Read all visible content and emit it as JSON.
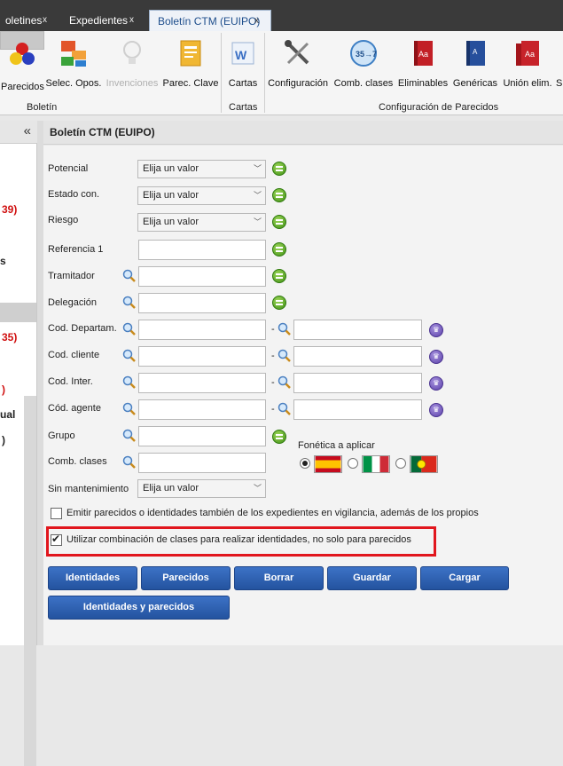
{
  "tabs": [
    {
      "label": "oletines",
      "close": "x"
    },
    {
      "label": "Expedientes",
      "close": "x"
    },
    {
      "label": "Boletín CTM (EUIPO)",
      "close": "x",
      "active": true
    }
  ],
  "ribbon": {
    "buttons": [
      {
        "label": "Parecidos",
        "icon": "dots-icon",
        "selected": true
      },
      {
        "label": "Selec. Opos.",
        "icon": "blocks-icon"
      },
      {
        "label": "Invenciones",
        "icon": "bulb-icon",
        "disabled": true
      },
      {
        "label": "Parec. Clave",
        "icon": "key-card-icon"
      },
      {
        "label": "Cartas",
        "icon": "word-doc-icon"
      },
      {
        "label": "Configuración",
        "icon": "tools-icon"
      },
      {
        "label": "Comb. clases",
        "icon": "combine-classes-icon"
      },
      {
        "label": "Eliminables",
        "icon": "red-dictionary-icon"
      },
      {
        "label": "Genéricas",
        "icon": "blue-book-icon"
      },
      {
        "label": "Unión elim.",
        "icon": "red-books-icon"
      },
      {
        "label": "S",
        "icon": ""
      }
    ],
    "groups": [
      "Boletín",
      "Cartas",
      "Configuración de Parecidos"
    ]
  },
  "left_panel": {
    "collapse": "«",
    "fragments": [
      {
        "text": "39)",
        "red": true
      },
      {
        "text": "s",
        "red": false
      },
      {
        "text": "35)",
        "red": true
      },
      {
        "text": ")",
        "red": true
      },
      {
        "text": "ual",
        "red": false
      },
      {
        "text": ")",
        "red": false
      }
    ]
  },
  "panel": {
    "title": "Boletín CTM (EUIPO)",
    "fields": {
      "potencial": {
        "label": "Potencial",
        "value": "Elija un valor"
      },
      "estado": {
        "label": "Estado con.",
        "value": "Elija un valor"
      },
      "riesgo": {
        "label": "Riesgo",
        "value": "Elija un valor"
      },
      "referencia": {
        "label": "Referencia 1",
        "value": ""
      },
      "tramitador": {
        "label": "Tramitador",
        "value": ""
      },
      "delegacion": {
        "label": "Delegación",
        "value": ""
      },
      "departam": {
        "label": "Cod. Departam.",
        "from": "",
        "to": ""
      },
      "cliente": {
        "label": "Cod. cliente",
        "from": "",
        "to": ""
      },
      "inter": {
        "label": "Cod. Inter.",
        "from": "",
        "to": ""
      },
      "agente": {
        "label": "Cód. agente",
        "from": "",
        "to": ""
      },
      "grupo": {
        "label": "Grupo",
        "value": ""
      },
      "comb": {
        "label": "Comb. clases",
        "value": ""
      },
      "sinmant": {
        "label": "Sin mantenimiento",
        "value": "Elija un valor"
      }
    },
    "range_sep": "-",
    "fonetica": {
      "label": "Fonética a aplicar",
      "options": [
        {
          "flag": "spain-flag-icon",
          "selected": true
        },
        {
          "flag": "italy-flag-icon",
          "selected": false
        },
        {
          "flag": "portugal-flag-icon",
          "selected": false
        }
      ]
    },
    "checkboxes": [
      {
        "label": "Emitir parecidos o identidades también de los expedientes en vigilancia, además de los propios",
        "checked": false
      },
      {
        "label": "Utilizar combinación de clases para realizar identidades, no solo para parecidos",
        "checked": true
      }
    ],
    "buttons": {
      "identidades": "Identidades",
      "parecidos": "Parecidos",
      "borrar": "Borrar",
      "guardar": "Guardar",
      "cargar": "Cargar",
      "ambos": "Identidades y parecidos"
    },
    "colors": {
      "button": "#2d5fb0",
      "highlight": "#e1161d",
      "accent_red": "#d01010"
    }
  }
}
